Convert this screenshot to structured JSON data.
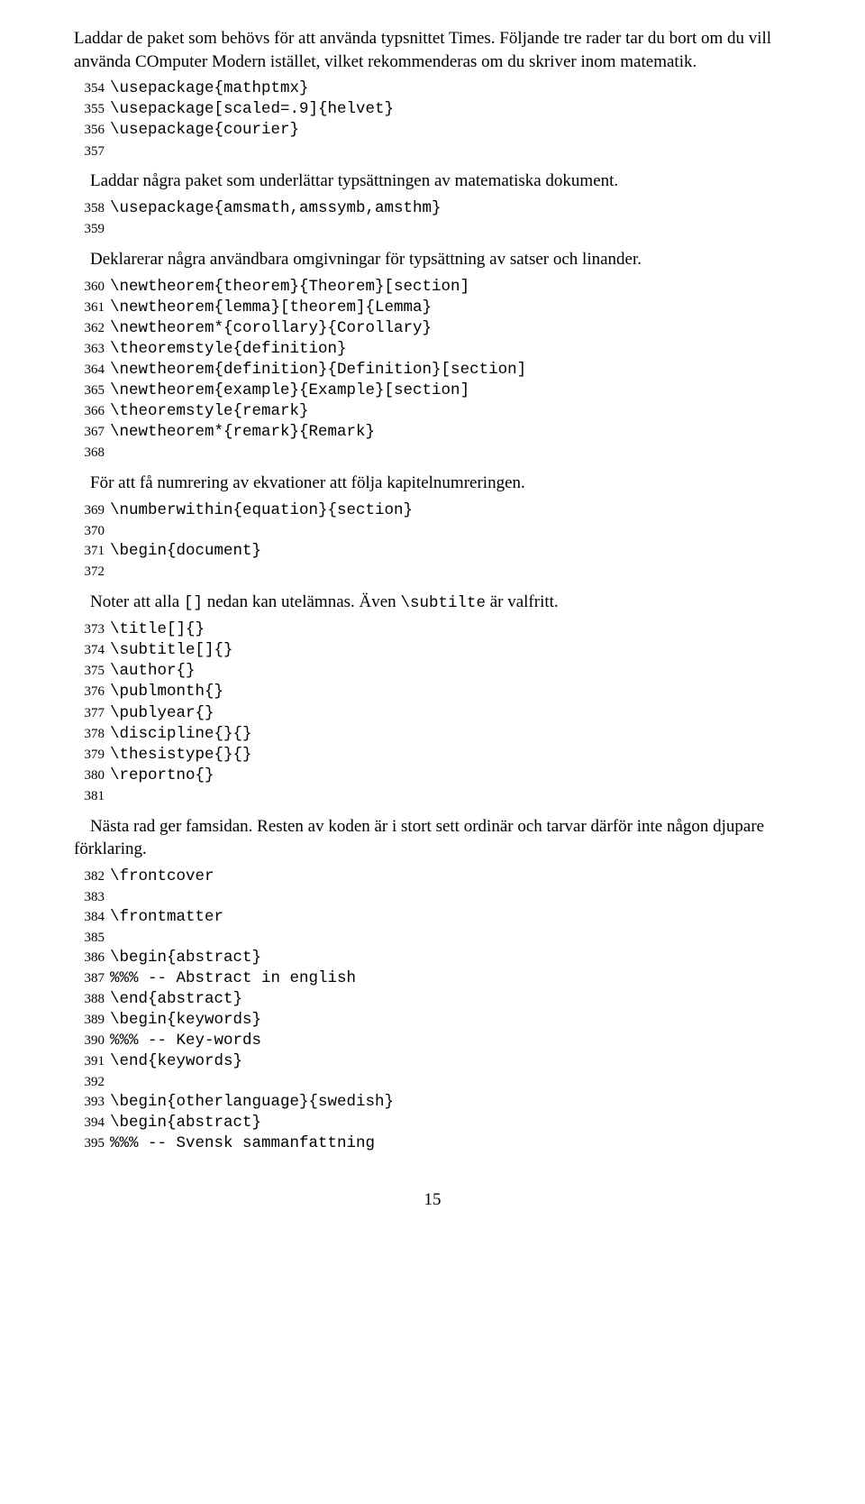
{
  "paragraphs": {
    "p1": "Laddar de paket som behövs för att använda typsnittet Times. Följande tre rader tar du bort om du vill använda COmputer Modern istället, vilket rekommenderas om du skriver inom matematik.",
    "p2": "Laddar några paket som underlättar typsättningen av matematiska dokument.",
    "p3": "Deklarerar några användbara omgivningar för typsättning av satser och linander.",
    "p4": "För att få numrering av ekvationer att följa kapitelnumreringen.",
    "p5_pre": "Noter att alla ",
    "p5_code1": "[]",
    "p5_mid": " nedan kan utelämnas. Även ",
    "p5_code2": "\\subtilte",
    "p5_post": " är valfritt.",
    "p6": "Nästa rad ger famsidan. Resten av koden är i stort sett ordinär och tarvar därför inte någon djupare förklaring."
  },
  "code": {
    "l354": "\\usepackage{mathptmx}",
    "l355": "\\usepackage[scaled=.9]{helvet}",
    "l356": "\\usepackage{courier}",
    "l357": "",
    "l358": "\\usepackage{amsmath,amssymb,amsthm}",
    "l359": "",
    "l360": "\\newtheorem{theorem}{Theorem}[section]",
    "l361": "\\newtheorem{lemma}[theorem]{Lemma}",
    "l362": "\\newtheorem*{corollary}{Corollary}",
    "l363": "\\theoremstyle{definition}",
    "l364": "\\newtheorem{definition}{Definition}[section]",
    "l365": "\\newtheorem{example}{Example}[section]",
    "l366": "\\theoremstyle{remark}",
    "l367": "\\newtheorem*{remark}{Remark}",
    "l368": "",
    "l369": "\\numberwithin{equation}{section}",
    "l370": "",
    "l371": "\\begin{document}",
    "l372": "",
    "l373": "\\title[]{}",
    "l374": "\\subtitle[]{}",
    "l375": "\\author{}",
    "l376": "\\publmonth{}",
    "l377": "\\publyear{}",
    "l378": "\\discipline{}{}",
    "l379": "\\thesistype{}{}",
    "l380": "\\reportno{}",
    "l381": "",
    "l382": "\\frontcover",
    "l383": "",
    "l384": "\\frontmatter",
    "l385": "",
    "l386": "\\begin{abstract}",
    "l387": "%%% -- Abstract in english",
    "l388": "\\end{abstract}",
    "l389": "\\begin{keywords}",
    "l390": "%%% -- Key-words",
    "l391": "\\end{keywords}",
    "l392": "",
    "l393": "\\begin{otherlanguage}{swedish}",
    "l394": "\\begin{abstract}",
    "l395": "%%% -- Svensk sammanfattning"
  },
  "linenums": {
    "n354": "354",
    "n355": "355",
    "n356": "356",
    "n357": "357",
    "n358": "358",
    "n359": "359",
    "n360": "360",
    "n361": "361",
    "n362": "362",
    "n363": "363",
    "n364": "364",
    "n365": "365",
    "n366": "366",
    "n367": "367",
    "n368": "368",
    "n369": "369",
    "n370": "370",
    "n371": "371",
    "n372": "372",
    "n373": "373",
    "n374": "374",
    "n375": "375",
    "n376": "376",
    "n377": "377",
    "n378": "378",
    "n379": "379",
    "n380": "380",
    "n381": "381",
    "n382": "382",
    "n383": "383",
    "n384": "384",
    "n385": "385",
    "n386": "386",
    "n387": "387",
    "n388": "388",
    "n389": "389",
    "n390": "390",
    "n391": "391",
    "n392": "392",
    "n393": "393",
    "n394": "394",
    "n395": "395"
  },
  "pagenum": "15"
}
